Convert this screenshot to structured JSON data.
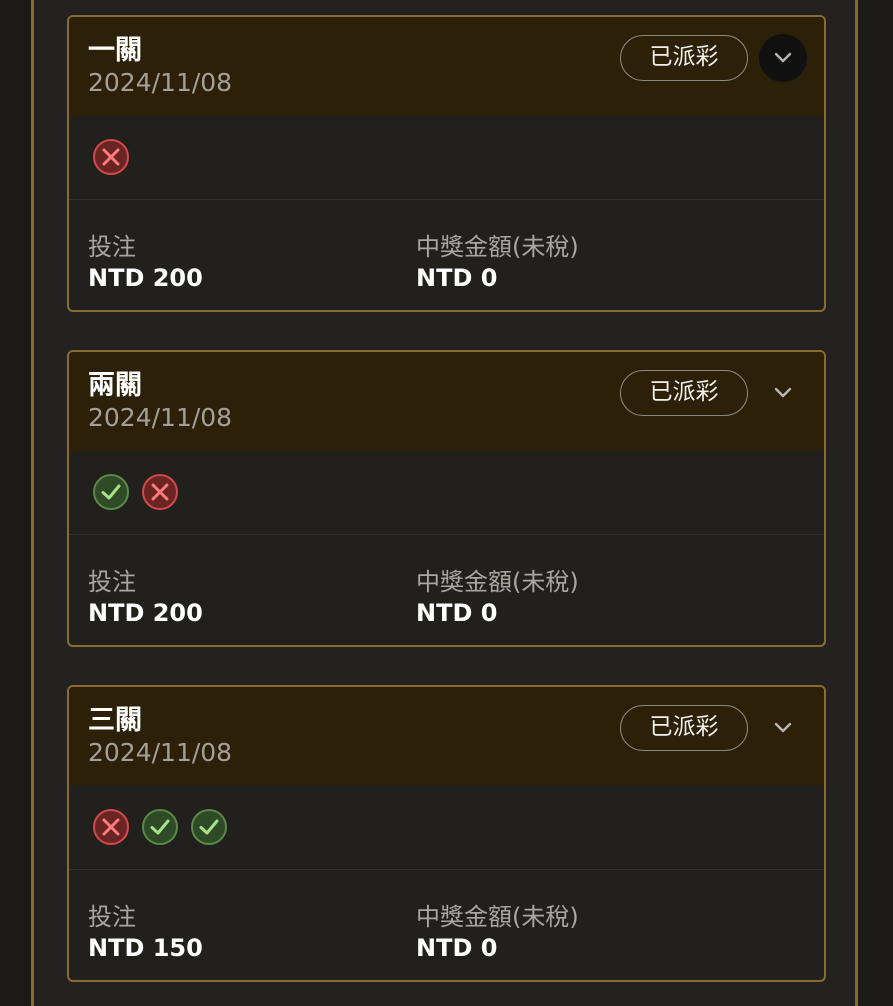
{
  "bets": [
    {
      "title": "一關",
      "date": "2024/11/08",
      "status": "已派彩",
      "toggle_icon": "chevron-down-icon",
      "results": [
        "loss"
      ],
      "stake_label": "投注",
      "stake_value": "NTD 200",
      "payout_label": "中獎金額(未稅)",
      "payout_value": "NTD 0"
    },
    {
      "title": "兩關",
      "date": "2024/11/08",
      "status": "已派彩",
      "toggle_icon": "chevron-down-icon",
      "results": [
        "win",
        "loss"
      ],
      "stake_label": "投注",
      "stake_value": "NTD 200",
      "payout_label": "中獎金額(未稅)",
      "payout_value": "NTD 0"
    },
    {
      "title": "三關",
      "date": "2024/11/08",
      "status": "已派彩",
      "toggle_icon": "chevron-down-icon",
      "results": [
        "loss",
        "win",
        "win"
      ],
      "stake_label": "投注",
      "stake_value": "NTD 150",
      "payout_label": "中獎金額(未稅)",
      "payout_value": "NTD 0"
    }
  ],
  "colors": {
    "accent_border": "#8a6b2d",
    "header_bg": "#2c2108",
    "win": "#5a8a46",
    "loss": "#d24a4a"
  }
}
